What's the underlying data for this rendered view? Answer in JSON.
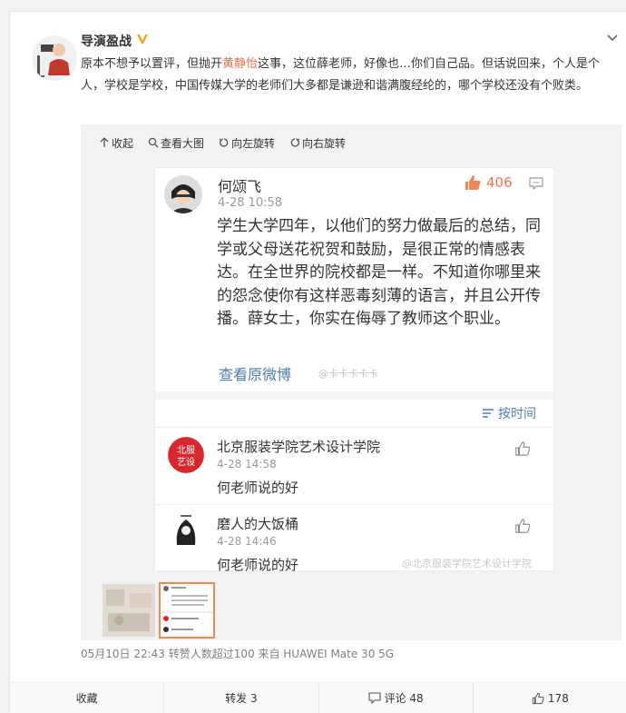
{
  "post": {
    "author": "导演盈战",
    "text_before": "原本不想予以置评，但抛开",
    "text_highlight": "黄静怡",
    "text_after": "这事，这位薛老师，好像也…你们自己品。但话说回来，个人是个人，学校是学校，中国传媒大学的老师们大多都是谦逊和谐满腹经纶的，哪个学校还没有个败类。",
    "meta": "05月10日 22:43 转赞人数超过100  来自 HUAWEI Mate 30 5G"
  },
  "toolbar": {
    "collapse": "收起",
    "view_large": "查看大图",
    "rotate_left": "向左旋转",
    "rotate_right": "向右旋转"
  },
  "screenshot": {
    "author": "何颂飞",
    "time": "4-28 10:58",
    "likes": "406",
    "body": "学生大学四年，以他们的努力做最后的总结，同学或父母送花祝贺和鼓励，是很正常的情感表达。在全世界的院校都是一样。不知道你哪里来的怨念使你有这样恶毒刻薄的语言，并且公开传播。薛女士，你实在侮辱了教师这个职业。",
    "view_original": "查看原微博",
    "sort_label": "按时间",
    "replies": [
      {
        "name": "北京服装学院艺术设计学院",
        "time": "4-28 14:58",
        "text": "何老师说的好"
      },
      {
        "name": "磨人的大饭桶",
        "time": "4-28 14:46",
        "text": "何老师说的好"
      }
    ]
  },
  "actions": {
    "favorite": "收藏",
    "repost": "转发 3",
    "comment": "评论 48",
    "like": "178"
  },
  "colors": {
    "highlight": "#eb7350",
    "link": "#507daf",
    "badge": "#f5a623",
    "thumb_border": "#f08a50"
  }
}
